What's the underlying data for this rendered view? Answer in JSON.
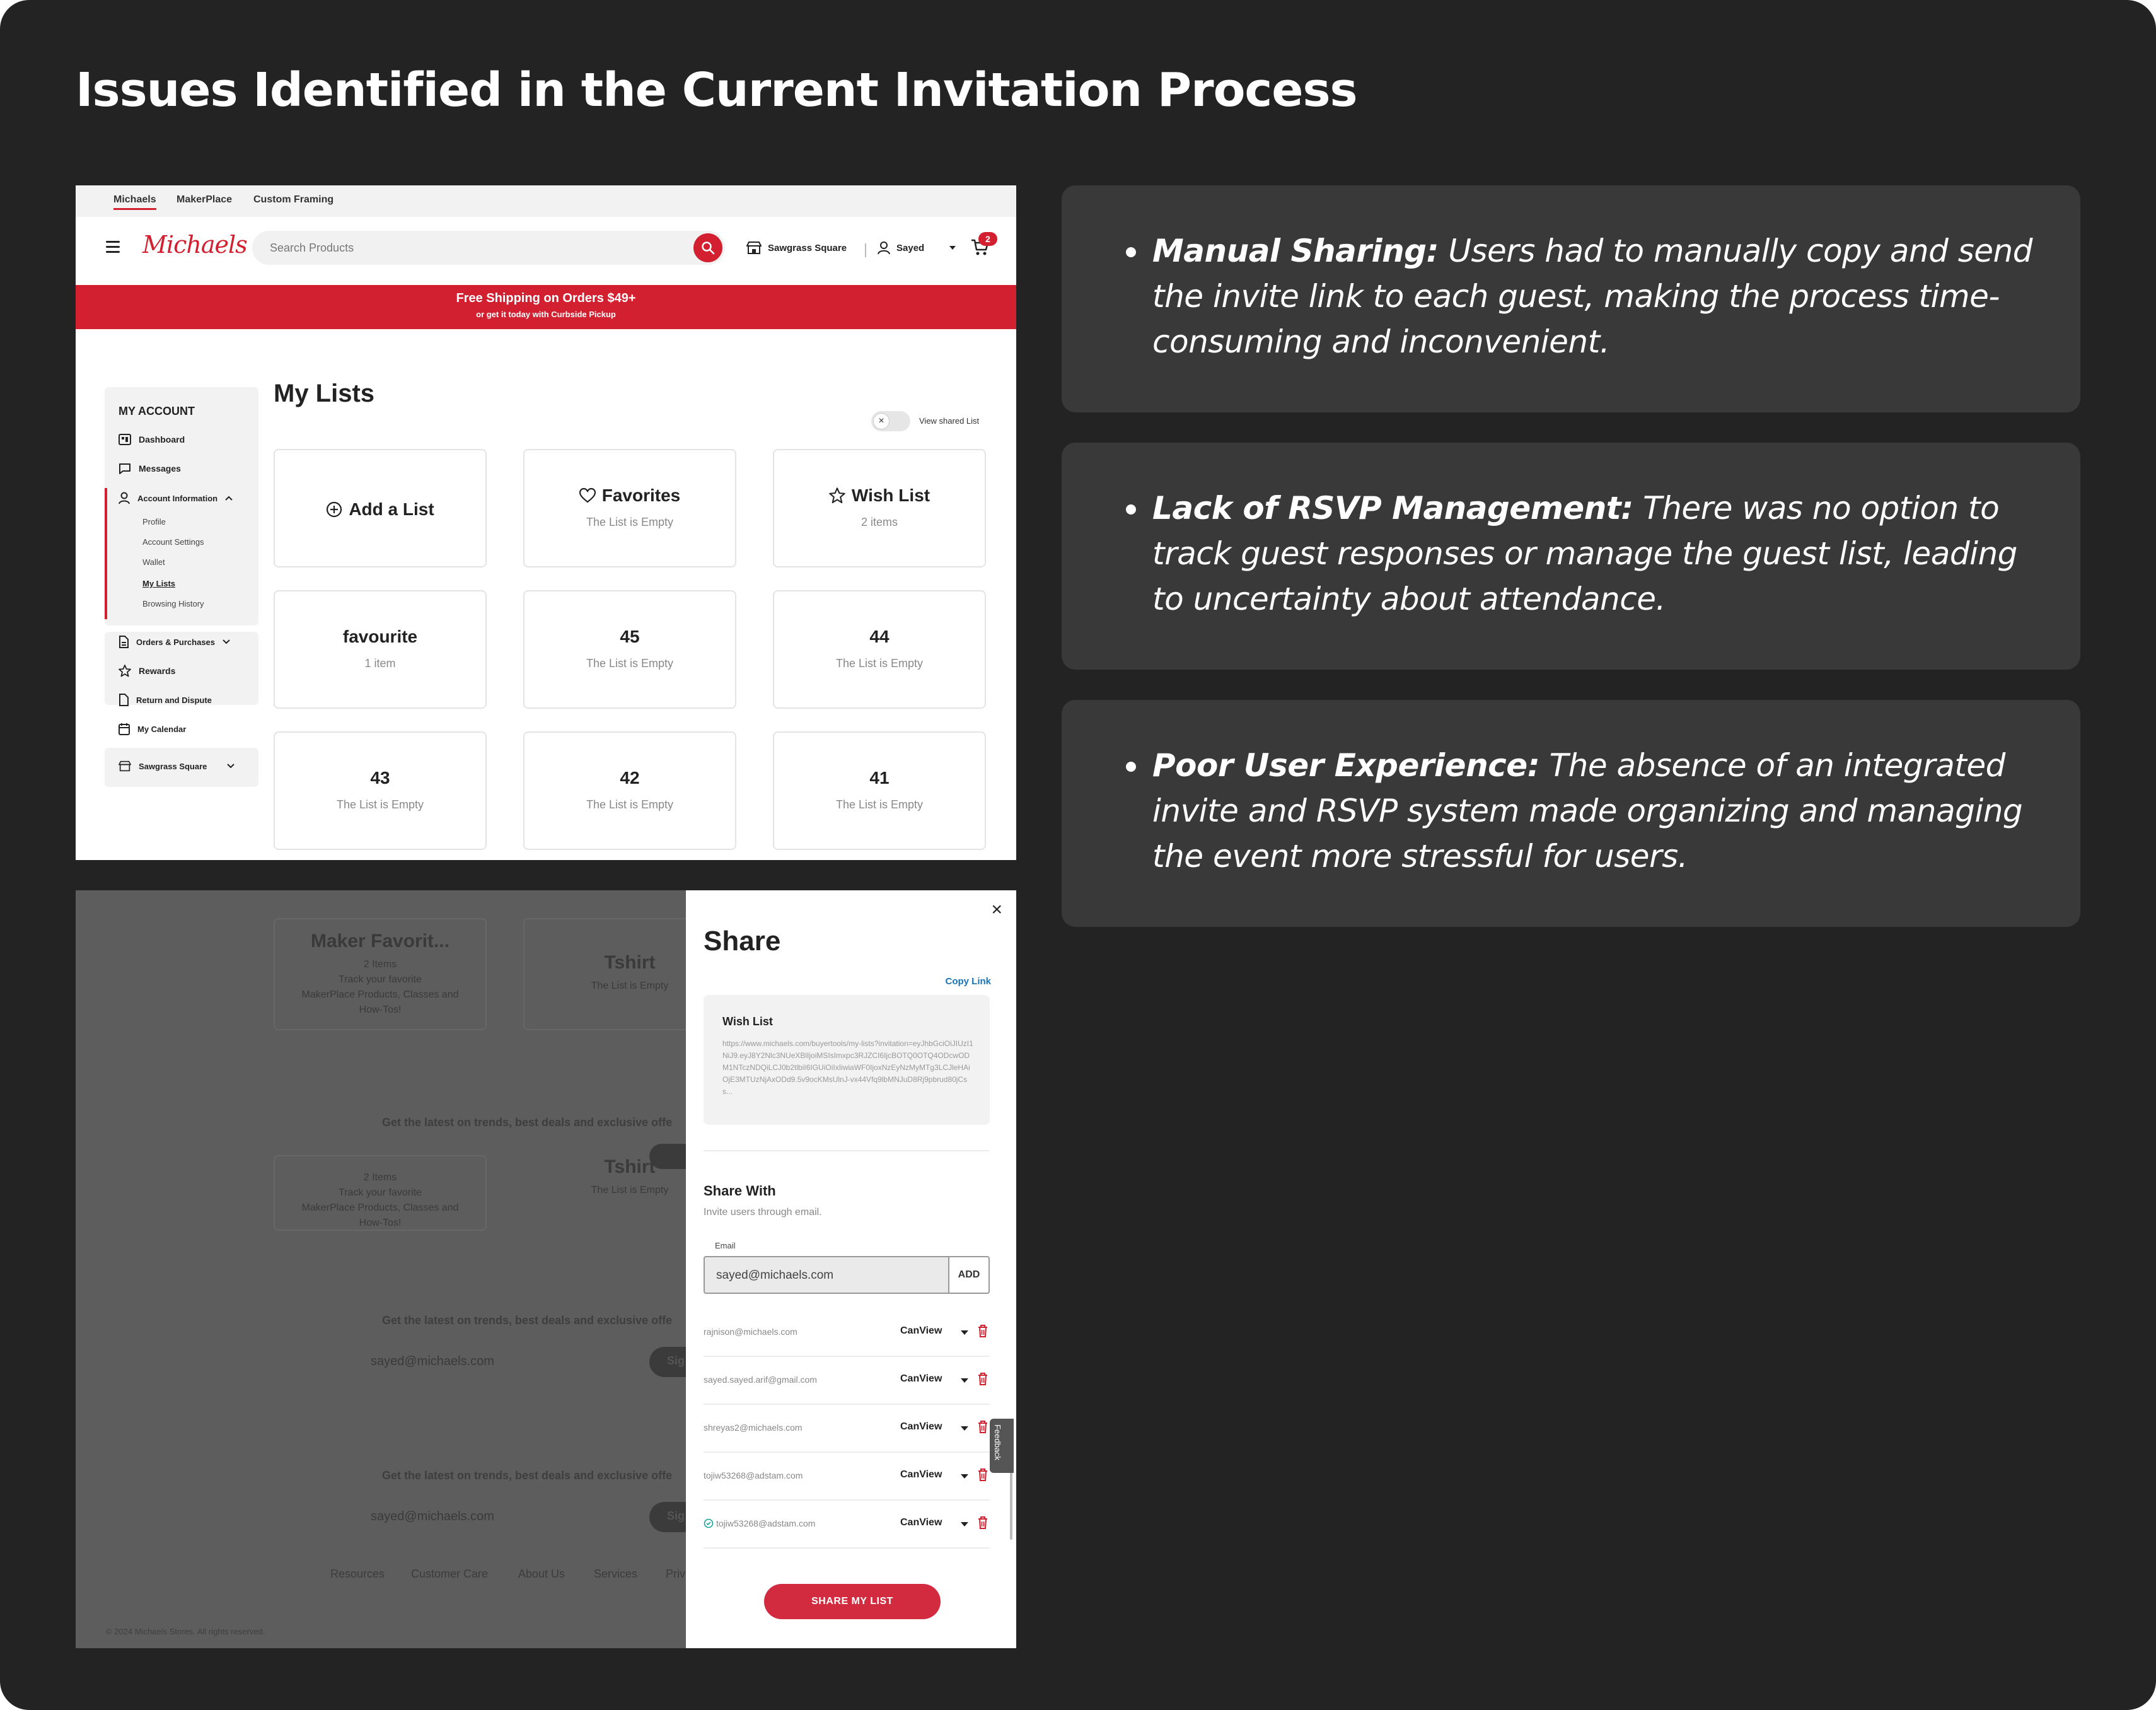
{
  "title": "Issues Identified in the Current Invitation Process",
  "mylists": {
    "tabs": [
      "Michaels",
      "MakerPlace",
      "Custom Framing"
    ],
    "logo": "Michaels",
    "search_placeholder": "Search Products",
    "store": "Sawgrass Square",
    "user": "Sayed",
    "cart_count": "2",
    "promo_line1": "Free Shipping on Orders $49+",
    "promo_line2": "or get it today with Curbside Pickup",
    "sidebar": {
      "heading": "MY ACCOUNT",
      "dashboard": "Dashboard",
      "messages": "Messages",
      "account_info": "Account Information",
      "sub": [
        "Profile",
        "Account Settings",
        "Wallet",
        "My Lists",
        "Browsing History"
      ],
      "orders": "Orders & Purchases",
      "rewards": "Rewards",
      "return": "Return and Dispute",
      "calendar": "My Calendar",
      "store": "Sawgrass Square"
    },
    "page_title": "My Lists",
    "toggle_label": "View shared List",
    "cards": [
      {
        "title": "Add a List",
        "subtitle": ""
      },
      {
        "title": "Favorites",
        "subtitle": "The List is Empty"
      },
      {
        "title": "Wish List",
        "subtitle": "2 items"
      },
      {
        "title": "favourite",
        "subtitle": "1 item"
      },
      {
        "title": "45",
        "subtitle": "The List is Empty"
      },
      {
        "title": "44",
        "subtitle": "The List is Empty"
      },
      {
        "title": "43",
        "subtitle": "The List is Empty"
      },
      {
        "title": "42",
        "subtitle": "The List is Empty"
      },
      {
        "title": "41",
        "subtitle": "The List is Empty"
      }
    ]
  },
  "share": {
    "bg": {
      "card1_title": "Maker Favorit...",
      "card1_sub": "2 Items",
      "card1_desc1": "Track your favorite",
      "card1_desc2": "MakerPlace Products, Classes and",
      "card1_desc3": "How-Tos!",
      "card2_title": "Tshirt",
      "card2_sub": "The List is Empty",
      "promo": "Get the latest on trends, best deals and exclusive offe",
      "email": "sayed@michaels.com",
      "sign": "Sig",
      "footer": [
        "Resources",
        "Customer Care",
        "About Us",
        "Services",
        "Priv"
      ],
      "copyright": "© 2024 Michaels Stores. All rights reserved."
    },
    "title": "Share",
    "copy_link": "Copy Link",
    "list_name": "Wish List",
    "url": "https://www.michaels.com/buyertools/my-lists?invitation=eyJhbGciOiJIUzI1NiJ9.eyJ8Y2Nlc3NUeXBlIjoiMSIsImxpc3RJZCI6IjcBOTQ0OTQ4ODcwODM1NTczNDQiLCJ0b2tlbiI6IGUiOiIxIiwiaWF0IjoxNzEyNzMyMTg3LCJleHAiOjE3MTUzNjAxODd9.5v9ocKMsUlnJ-vx44Vfq9lbMNJuD8Rj9pbrud80jCss...",
    "share_with": "Share With",
    "share_with_sub": "Invite users through email.",
    "email_label": "Email",
    "email_value": "sayed@michaels.com",
    "add_label": "ADD",
    "rows": [
      {
        "email": "rajnison@michaels.com",
        "perm": "CanView"
      },
      {
        "email": "sayed.sayed.arif@gmail.com",
        "perm": "CanView"
      },
      {
        "email": "shreyas2@michaels.com",
        "perm": "CanView"
      },
      {
        "email": "tojiw53268@adstam.com",
        "perm": "CanView"
      },
      {
        "email": "tojiw53268@adstam.com",
        "perm": "CanView"
      }
    ],
    "share_button": "SHARE MY LIST",
    "feedback": "Feedback"
  },
  "issues": [
    {
      "label": "Manual Sharing:",
      "text": " Users had to manually copy and send the invite link to each guest, making the process time-consuming and inconvenient."
    },
    {
      "label": "Lack of RSVP Management:",
      "text": " There was no option to track guest responses or manage the guest list, leading to uncertainty about attendance."
    },
    {
      "label": "Poor User Experience:",
      "text": " The absence of an integrated invite and RSVP system made organizing and managing the event more stressful for users."
    }
  ]
}
